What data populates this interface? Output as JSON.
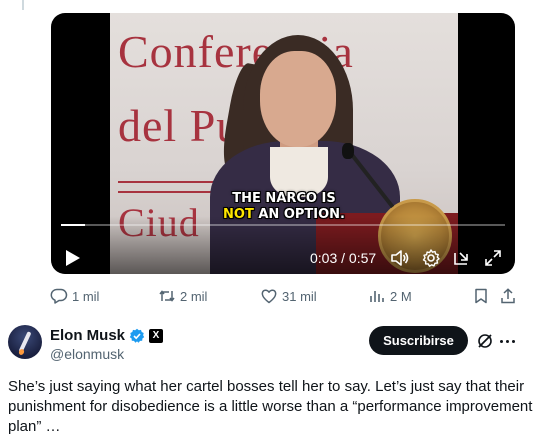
{
  "video": {
    "banner_line1": "Conferencia",
    "banner_line2": "del Pueblo",
    "banner_line3": "Ciud",
    "caption_line1": "THE NARCO IS",
    "caption_highlight": "NOT",
    "caption_rest": " AN OPTION.",
    "time": "0:03 / 0:57",
    "progress_fraction": 0.053
  },
  "actions": {
    "replies": "1 mil",
    "reposts": "2 mil",
    "likes": "31 mil",
    "views": "2 M"
  },
  "author": {
    "name": "Elon Musk",
    "handle": "@elonmusk",
    "x_badge": "X",
    "subscribe_label": "Suscribirse"
  },
  "tweet": {
    "text": "She’s just saying what her cartel bosses tell her to say. Let’s just say that their punishment for disobedience is a little worse than a “performance improvement plan” …"
  },
  "colors": {
    "muted": "#536471",
    "verified": "#1d9bf0",
    "caption_highlight": "#ffe600",
    "banner_red": "#a7333f"
  },
  "icons": [
    "reply-icon",
    "repost-icon",
    "like-icon",
    "views-icon",
    "bookmark-icon",
    "share-icon",
    "play-icon",
    "volume-icon",
    "settings-icon",
    "exit-fullscreen-icon",
    "fullscreen-icon",
    "verified-icon",
    "grok-icon",
    "more-icon"
  ]
}
